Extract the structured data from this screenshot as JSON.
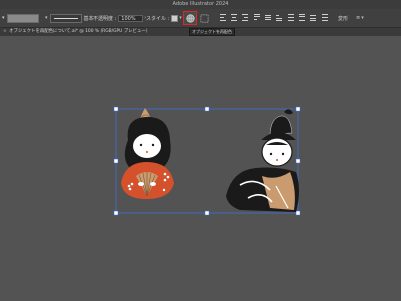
{
  "app": {
    "title": "Adobe Illustrator 2024"
  },
  "toolbar": {
    "stroke_label": "基本",
    "opacity_label": "不透明度 :",
    "opacity_value": "100%",
    "style_label": "スタイル :",
    "tooltip": "オブジェクトを再配色",
    "right_label": "変形"
  },
  "document": {
    "tab_title": "オブジェクトを再配色について.ai* @ 100 % (RGB/GPU プレビュー)"
  },
  "colors": {
    "canvas": "#535353",
    "selection": "#3d6fd6",
    "highlight": "#e0281e",
    "kimono_red": "#d4512c",
    "skin": "#ffffff",
    "hair": "#1a1a1a",
    "tan": "#c99b6f"
  },
  "icons": [
    "recolor-globe-icon",
    "align-icon",
    "transform-icon",
    "close-icon",
    "chevron-down-icon"
  ]
}
